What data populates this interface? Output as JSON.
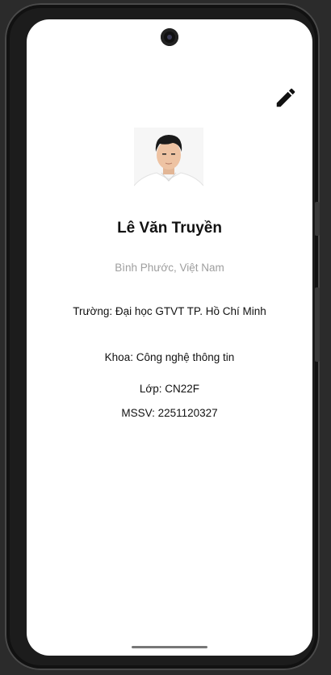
{
  "toolbar": {
    "edit_icon": "pencil-edit-icon"
  },
  "profile": {
    "avatar": "portrait-photo",
    "name": "Lê Văn Truyền",
    "location": "Bình Phước, Việt Nam",
    "school": "Trường: Đại học GTVT TP. Hồ Chí Minh",
    "faculty": "Khoa: Công nghệ thông tin",
    "class": "Lớp: CN22F",
    "student_id": "MSSV: 2251120327"
  },
  "colors": {
    "background": "#ffffff",
    "primary_text": "#111111",
    "secondary_text": "#9e9e9e",
    "device_frame": "#1c1c1c"
  }
}
